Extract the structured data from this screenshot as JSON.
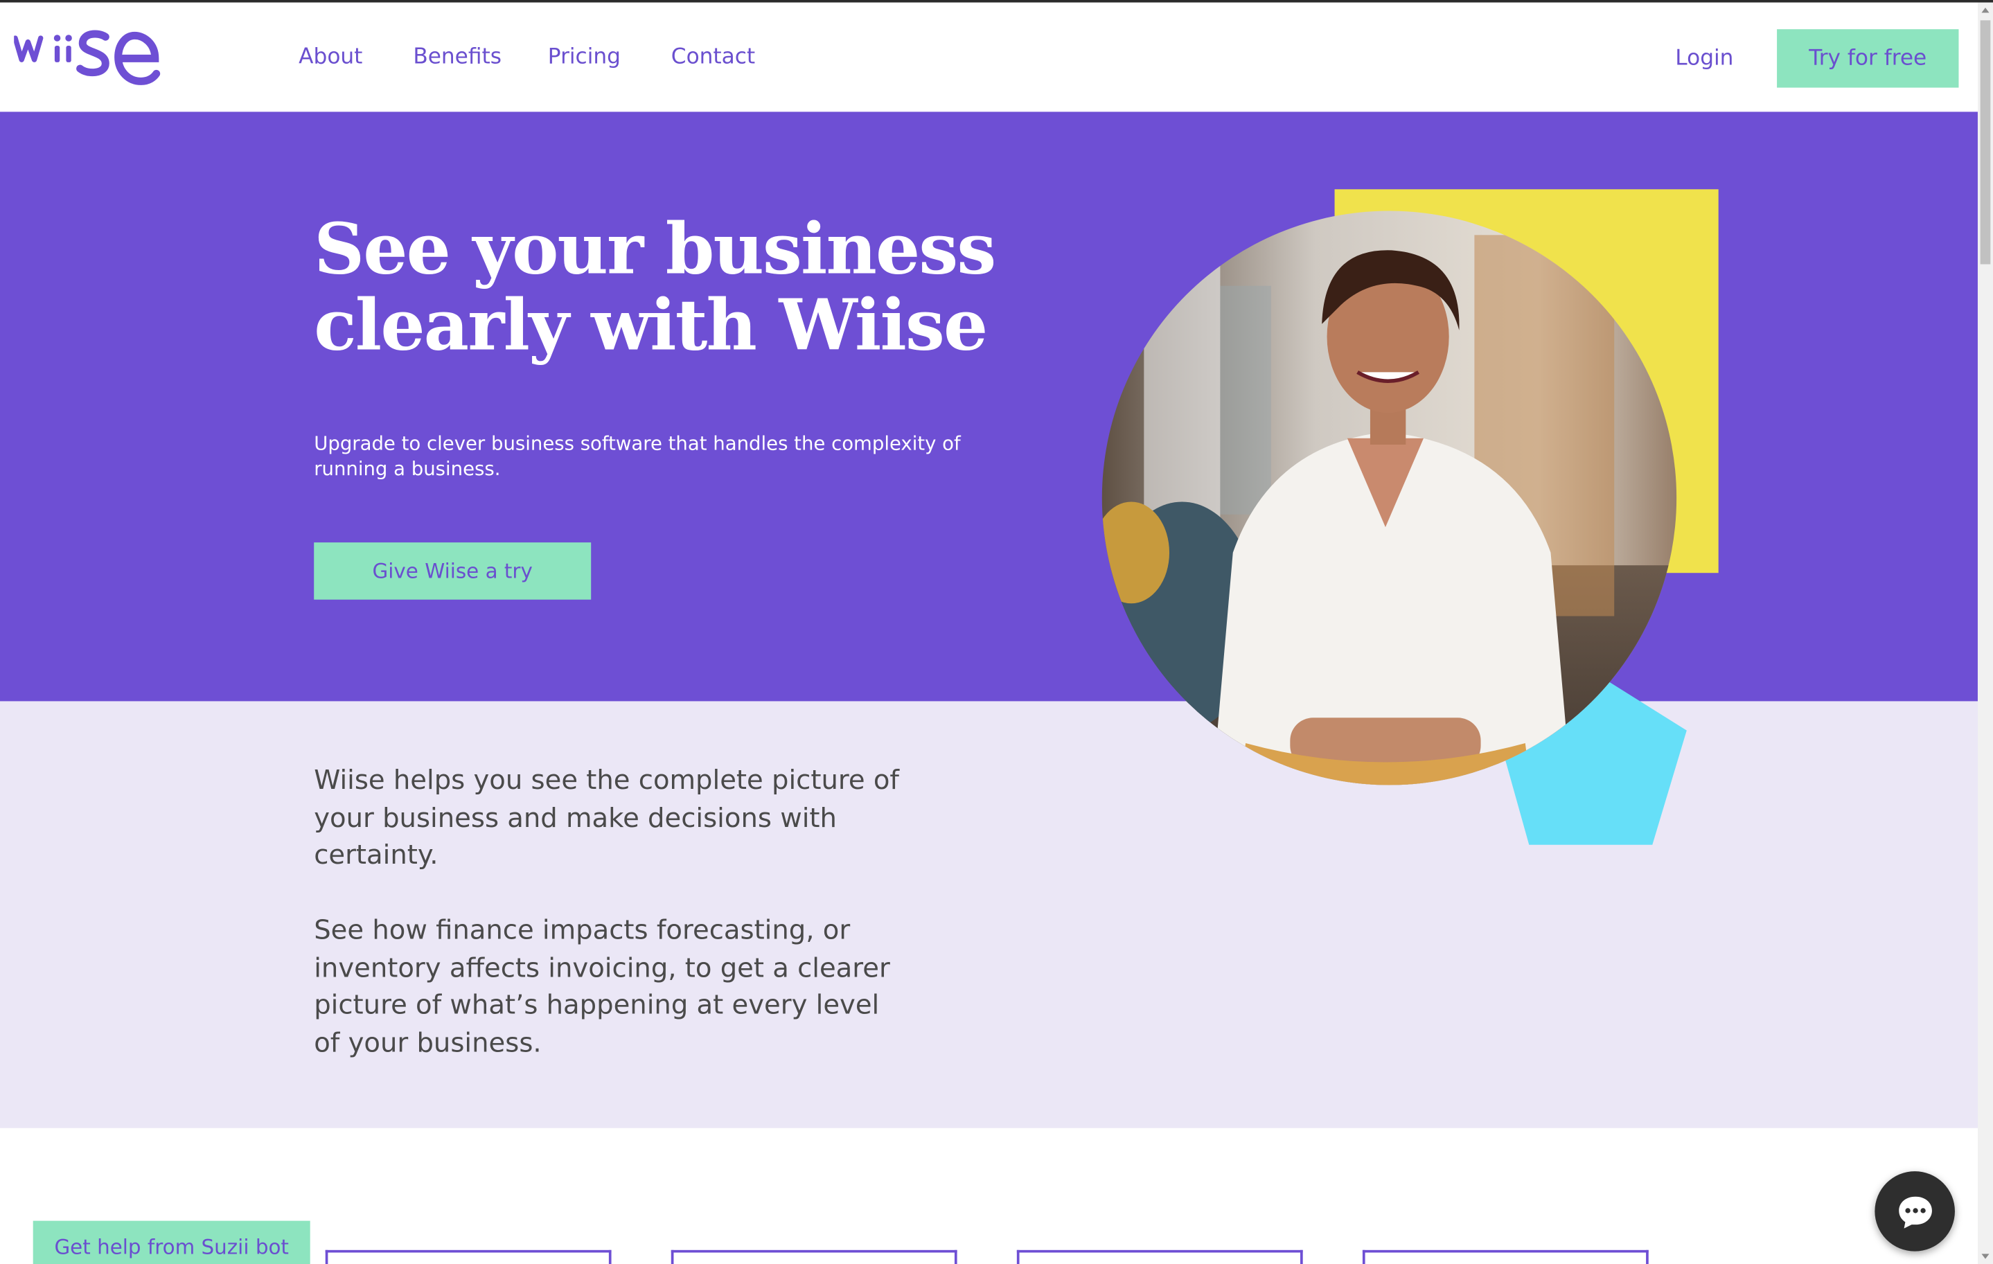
{
  "brand": {
    "logo_text": "wiise",
    "primary_color": "#6e4fd4",
    "accent_color": "#8de4bf"
  },
  "nav": {
    "items": [
      {
        "label": "About"
      },
      {
        "label": "Benefits"
      },
      {
        "label": "Pricing"
      },
      {
        "label": "Contact"
      }
    ],
    "login_label": "Login",
    "try_label": "Try for free"
  },
  "hero": {
    "title_line1": "See your business",
    "title_line2": "clearly with Wiise",
    "subtitle": "Upgrade to clever business software that handles the complexity of running a business.",
    "cta_label": "Give Wiise a try",
    "shapes": {
      "square_color": "#f0e24c",
      "pentagon_color": "#66dff8"
    }
  },
  "intro": {
    "paragraph1": "Wiise helps you see the complete picture of your business and make decisions with certainty.",
    "paragraph2": "See how finance impacts forecasting, or inventory affects invoicing, to get a clearer picture of what’s happening at every level of your business."
  },
  "help": {
    "label": "Get help from Suzii bot"
  },
  "chat": {
    "icon": "chat-bubble-icon"
  }
}
